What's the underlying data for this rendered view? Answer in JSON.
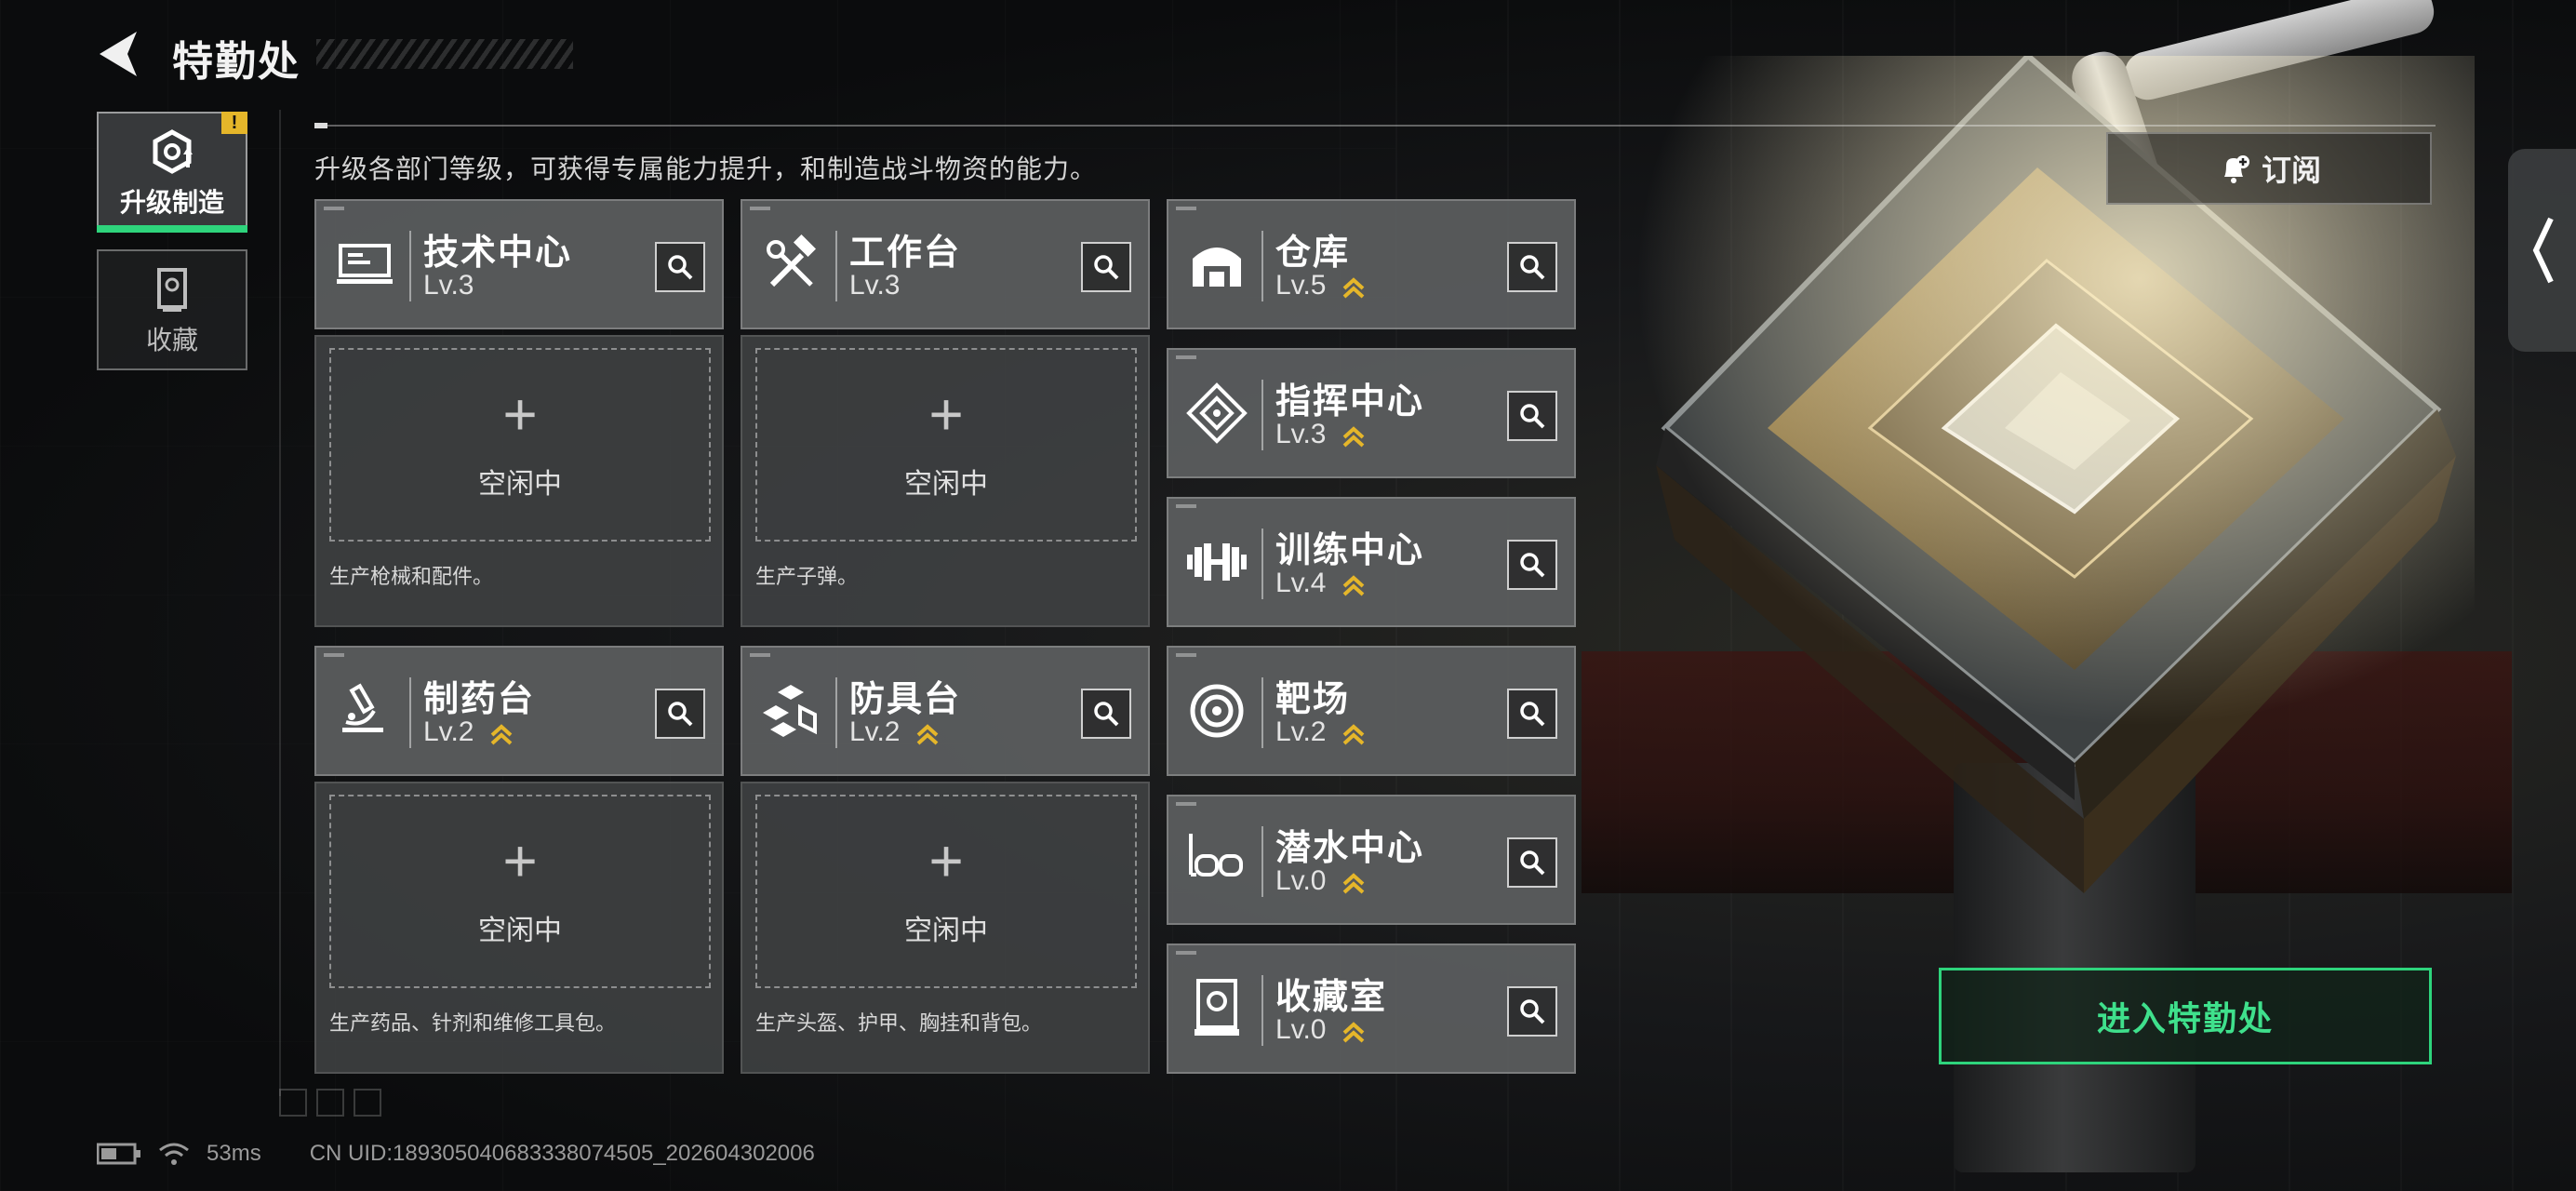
{
  "header": {
    "title": "特勤处",
    "subtitle": "升级各部门等级，可获得专属能力提升，和制造战斗物资的能力。"
  },
  "tabs": [
    {
      "label": "升级制造",
      "active": true,
      "badge": "!"
    },
    {
      "label": "收藏",
      "active": false
    }
  ],
  "production": [
    {
      "name": "技术中心",
      "level": "Lv.3",
      "upgradable": false,
      "idle_text": "空闲中",
      "desc": "生产枪械和配件。",
      "icon": "monitor-icon"
    },
    {
      "name": "工作台",
      "level": "Lv.3",
      "upgradable": false,
      "idle_text": "空闲中",
      "desc": "生产子弹。",
      "icon": "hammer-wrench-icon"
    },
    {
      "name": "制药台",
      "level": "Lv.2",
      "upgradable": true,
      "idle_text": "空闲中",
      "desc": "生产药品、针剂和维修工具包。",
      "icon": "microscope-icon"
    },
    {
      "name": "防具台",
      "level": "Lv.2",
      "upgradable": true,
      "idle_text": "空闲中",
      "desc": "生产头盔、护甲、胸挂和背包。",
      "icon": "cubes-icon"
    }
  ],
  "facilities": [
    {
      "name": "仓库",
      "level": "Lv.5",
      "upgradable": true,
      "icon": "warehouse-icon"
    },
    {
      "name": "指挥中心",
      "level": "Lv.3",
      "upgradable": true,
      "icon": "diamond-target-icon"
    },
    {
      "name": "训练中心",
      "level": "Lv.4",
      "upgradable": true,
      "icon": "dumbbell-icon"
    },
    {
      "name": "靶场",
      "level": "Lv.2",
      "upgradable": true,
      "icon": "bullseye-icon"
    },
    {
      "name": "潜水中心",
      "level": "Lv.0",
      "upgradable": true,
      "icon": "diving-mask-icon"
    },
    {
      "name": "收藏室",
      "level": "Lv.0",
      "upgradable": true,
      "icon": "trophy-case-icon"
    }
  ],
  "buttons": {
    "subscribe": "订阅",
    "enter": "进入特勤处"
  },
  "status_bar": {
    "ping": "53ms",
    "uid": "CN UID:18930504068333807450​5_202604302006"
  },
  "colors": {
    "accent": "#2ed47c",
    "upgrade": "#e5b62a",
    "badge": "#e5b62a"
  }
}
